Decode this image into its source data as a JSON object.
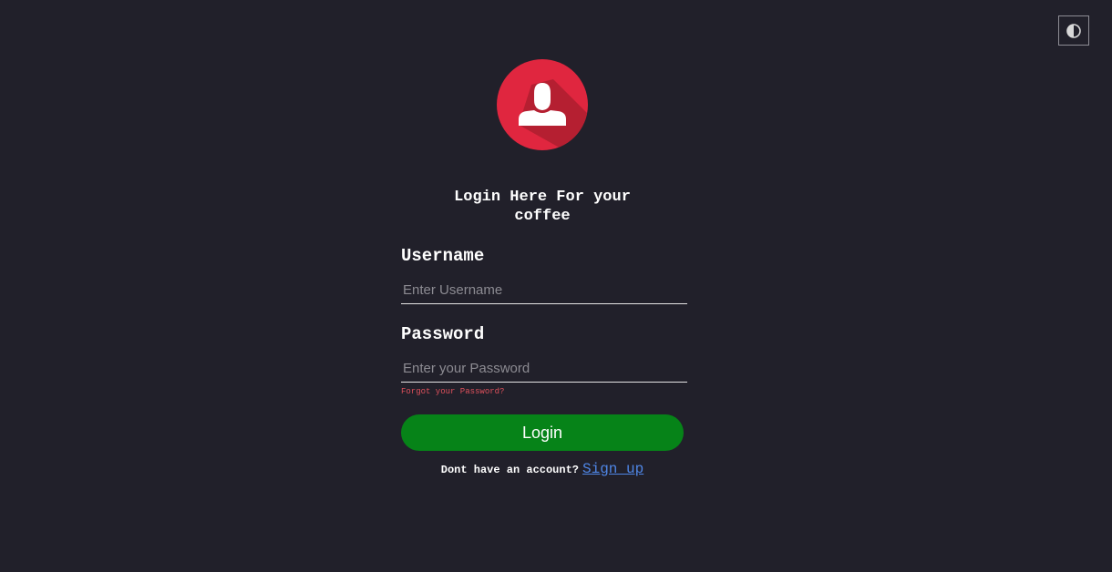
{
  "theme_toggle": {
    "icon": "contrast-icon"
  },
  "avatar": {
    "icon": "user-icon",
    "background_color": "#e0263f"
  },
  "heading": "Login Here For your coffee",
  "username": {
    "label": "Username",
    "placeholder": "Enter Username",
    "value": ""
  },
  "password": {
    "label": "Password",
    "placeholder": "Enter your Password",
    "value": ""
  },
  "forgot_password": "Forgot your Password?",
  "login_button": {
    "label": "Login",
    "color": "#068318"
  },
  "signup": {
    "prompt": "Dont have an account?",
    "link_label": "Sign up"
  },
  "colors": {
    "background": "#21202a",
    "link": "#4f86e6",
    "forgot_link": "#e0515c"
  }
}
